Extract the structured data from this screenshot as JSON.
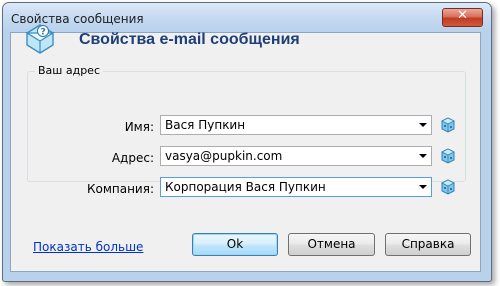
{
  "window": {
    "title": "Свойства сообщения",
    "close_glyph": "✕"
  },
  "header": {
    "icon": "message-properties-icon",
    "title": "Свойства e-mail сообщения"
  },
  "address_group": {
    "label": "Ваш адрес",
    "fields": [
      {
        "label": "Имя:",
        "value": "Вася Пупкин",
        "icon": "address-book-icon"
      },
      {
        "label": "Адрес:",
        "value": "vasya@pupkin.com",
        "icon": "address-book-icon"
      },
      {
        "label": "Компания:",
        "value": "Корпорация Вася Пупкин",
        "icon": "address-book-icon"
      }
    ]
  },
  "footer": {
    "more_link": "Показать больше",
    "ok": "Ok",
    "cancel": "Отмена",
    "help": "Справка"
  },
  "colors": {
    "title_blue": "#1f3f78",
    "link_blue": "#0033cc",
    "frame_blue": "#b9d1ea",
    "close_red": "#c23b22"
  }
}
